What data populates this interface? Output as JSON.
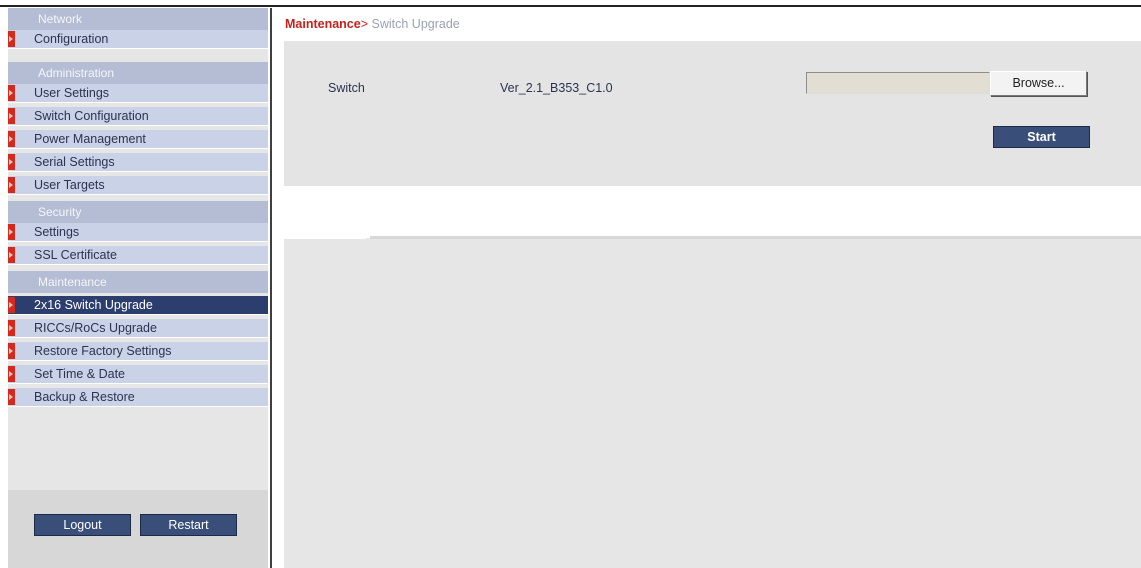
{
  "sidebar": {
    "sections": [
      {
        "title": "Network",
        "items": [
          "Configuration"
        ]
      },
      {
        "title": "Administration",
        "items": [
          "User Settings",
          "Switch Configuration",
          "Power Management",
          "Serial Settings",
          "User Targets"
        ]
      },
      {
        "title": "Security",
        "items": [
          "Settings",
          "SSL Certificate"
        ]
      },
      {
        "title": "Maintenance",
        "items": [
          "2x16 Switch Upgrade",
          "RICCs/RoCs Upgrade",
          "Restore Factory Settings",
          "Set Time & Date",
          "Backup & Restore"
        ]
      }
    ],
    "active_item": "2x16 Switch Upgrade",
    "logout_label": "Logout",
    "restart_label": "Restart"
  },
  "breadcrumb": {
    "root": "Maintenance",
    "separator": ">",
    "page": "Switch Upgrade"
  },
  "upgrade": {
    "device_label": "Switch",
    "version": "Ver_2.1_B353_C1.0",
    "file_value": "",
    "browse_label": "Browse...",
    "start_label": "Start"
  },
  "colors": {
    "accent_red": "#c8201c",
    "nav_active": "#2c3e6d",
    "button_dark": "#394f7a",
    "section_header": "#b4bdd3",
    "nav_item": "#c9d2e6"
  }
}
